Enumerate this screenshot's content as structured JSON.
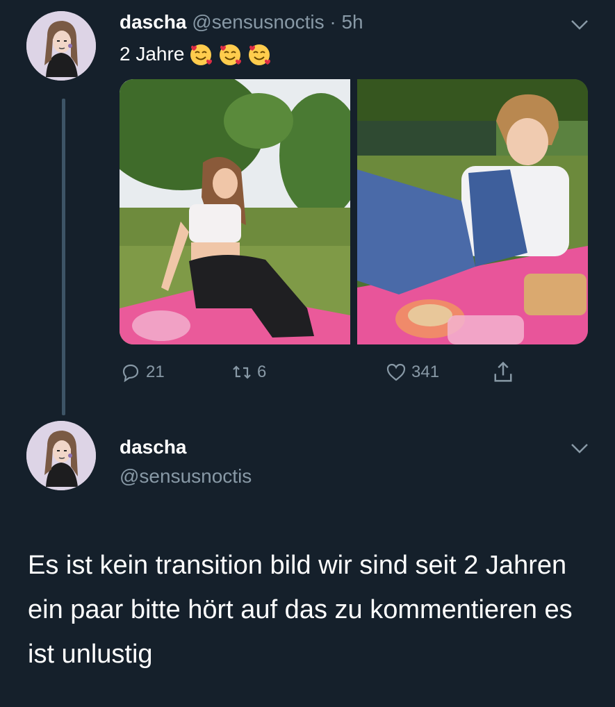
{
  "tweet": {
    "display_name": "dascha",
    "handle": "@sensusnoctis",
    "separator": "·",
    "time": "5h",
    "text": "2 Jahre",
    "emoji": "smiling-face-with-hearts-icon",
    "stats": {
      "replies": "21",
      "retweets": "6",
      "likes": "341"
    }
  },
  "reply": {
    "display_name": "dascha",
    "handle": "@sensusnoctis",
    "text": "Es ist kein transition bild wir sind seit 2 Jahren ein paar bitte hört auf das zu kommentieren es ist unlustig"
  },
  "colors": {
    "background": "#15202b",
    "secondary_text": "#8899a6",
    "thread_line": "#3d5466"
  }
}
